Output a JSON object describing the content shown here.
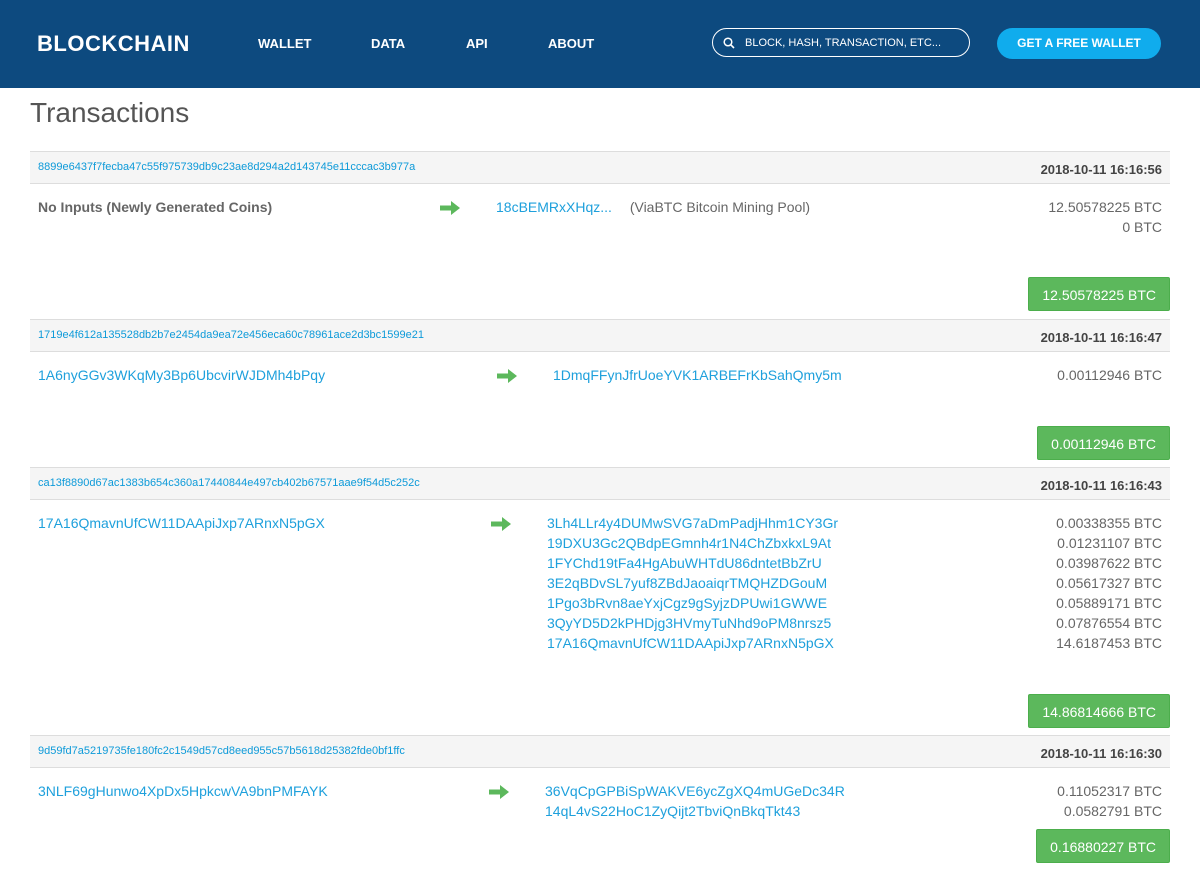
{
  "header": {
    "logo": "BLOCKCHAIN",
    "nav": [
      "WALLET",
      "DATA",
      "API",
      "ABOUT"
    ],
    "search_placeholder": "BLOCK, HASH, TRANSACTION, ETC...",
    "cta": "GET A FREE WALLET"
  },
  "page": {
    "title": "Transactions"
  },
  "transactions": [
    {
      "hash": "8899e6437f7fecba47c55f975739db9c23ae8d294a2d143745e11cccac3b977a",
      "time": "2018-10-11 16:16:56",
      "input": "No Inputs (Newly Generated Coins)",
      "outputs": [
        "18cBEMRxXHqz..."
      ],
      "output_label": "(ViaBTC Bitcoin Mining Pool)",
      "amounts": [
        "12.50578225 BTC",
        "0 BTC"
      ],
      "total": "12.50578225 BTC"
    },
    {
      "hash": "1719e4f612a135528db2b7e2454da9ea72e456eca60c78961ace2d3bc1599e21",
      "time": "2018-10-11 16:16:47",
      "input": "1A6nyGGv3WKqMy3Bp6UbcvirWJDMh4bPqy",
      "outputs": [
        "1DmqFFynJfrUoeYVK1ARBEFrKbSahQmy5m"
      ],
      "amounts": [
        "0.00112946 BTC"
      ],
      "total": "0.00112946 BTC"
    },
    {
      "hash": "ca13f8890d67ac1383b654c360a17440844e497cb402b67571aae9f54d5c252c",
      "time": "2018-10-11 16:16:43",
      "input": "17A16QmavnUfCW11DAApiJxp7ARnxN5pGX",
      "outputs": [
        "3Lh4LLr4y4DUMwSVG7aDmPadjHhm1CY3Gr",
        "19DXU3Gc2QBdpEGmnh4r1N4ChZbxkxL9At",
        "1FYChd19tFa4HgAbuWHTdU86dntetBbZrU",
        "3E2qBDvSL7yuf8ZBdJaoaiqrTMQHZDGouM",
        "1Pgo3bRvn8aeYxjCgz9gSyjzDPUwi1GWWE",
        "3QyYD5D2kPHDjg3HVmyTuNhd9oPM8nrsz5",
        "17A16QmavnUfCW11DAApiJxp7ARnxN5pGX"
      ],
      "amounts": [
        "0.00338355 BTC",
        "0.01231107 BTC",
        "0.03987622 BTC",
        "0.05617327 BTC",
        "0.05889171 BTC",
        "0.07876554 BTC",
        "14.6187453 BTC"
      ],
      "total": "14.86814666 BTC"
    },
    {
      "hash": "9d59fd7a5219735fe180fc2c1549d57cd8eed955c57b5618d25382fde0bf1ffc",
      "time": "2018-10-11 16:16:30",
      "input": "3NLF69gHunwo4XpDx5HpkcwVA9bnPMFAYK",
      "outputs": [
        "36VqCpGPBiSpWAKVE6ycZgXQ4mUGeDc34R",
        "14qL4vS22HoC1ZyQijt2TbviQnBkqTkt43"
      ],
      "amounts": [
        "0.11052317 BTC",
        "0.0582791 BTC"
      ],
      "total": "0.16880227 BTC"
    }
  ],
  "colors": {
    "header_bg": "#0d4a7f",
    "cta_bg": "#10aced",
    "link": "#1ea0dc",
    "total_bg": "#5cb85c",
    "arrow": "#5cb85c"
  }
}
